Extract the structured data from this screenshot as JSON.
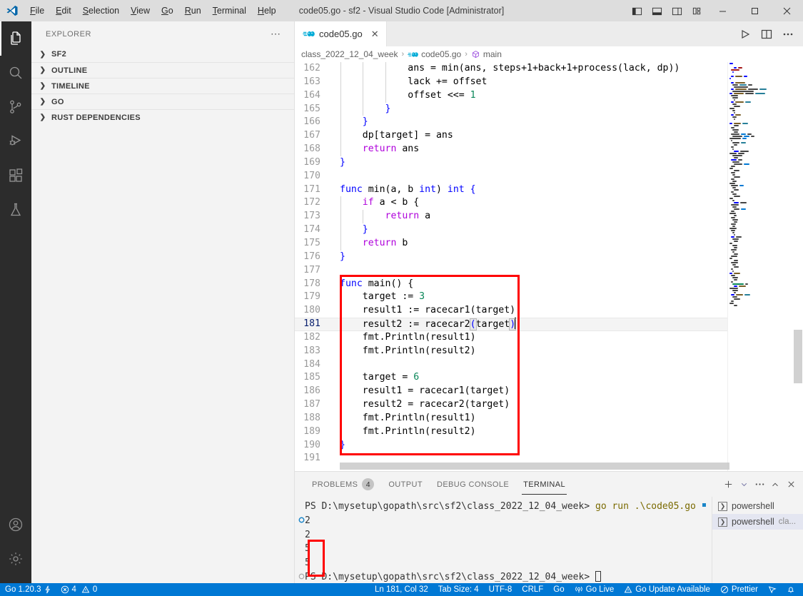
{
  "window": {
    "title": "code05.go - sf2 - Visual Studio Code [Administrator]",
    "menus": [
      {
        "label": "File",
        "mnemonic": "F"
      },
      {
        "label": "Edit",
        "mnemonic": "E"
      },
      {
        "label": "Selection",
        "mnemonic": "S"
      },
      {
        "label": "View",
        "mnemonic": "V"
      },
      {
        "label": "Go",
        "mnemonic": "G"
      },
      {
        "label": "Run",
        "mnemonic": "R"
      },
      {
        "label": "Terminal",
        "mnemonic": "T"
      },
      {
        "label": "Help",
        "mnemonic": "H"
      }
    ],
    "layout_buttons": [
      "toggle-primary-sidebar",
      "toggle-panel",
      "toggle-secondary-sidebar",
      "customize-layout"
    ],
    "controls": {
      "minimize": "─",
      "maximize": "☐",
      "close": "✕"
    }
  },
  "activitybar": {
    "items": [
      {
        "name": "explorer",
        "icon": "files-icon",
        "active": true
      },
      {
        "name": "search",
        "icon": "search-icon",
        "active": false
      },
      {
        "name": "source-control",
        "icon": "source-control-icon",
        "active": false
      },
      {
        "name": "run-and-debug",
        "icon": "debug-icon",
        "active": false
      },
      {
        "name": "extensions",
        "icon": "extensions-icon",
        "active": false
      },
      {
        "name": "testing",
        "icon": "beaker-icon",
        "active": false
      }
    ],
    "bottom": [
      {
        "name": "accounts",
        "icon": "account-icon"
      },
      {
        "name": "manage",
        "icon": "gear-icon"
      }
    ]
  },
  "sidebar": {
    "title": "EXPLORER",
    "more_actions": "⋯",
    "sections": [
      {
        "label": "SF2",
        "expanded": false
      },
      {
        "label": "OUTLINE",
        "expanded": false
      },
      {
        "label": "TIMELINE",
        "expanded": false
      },
      {
        "label": "GO",
        "expanded": false
      },
      {
        "label": "RUST DEPENDENCIES",
        "expanded": false
      }
    ]
  },
  "editor": {
    "tab": {
      "label": "code05.go",
      "icon": "go-file-icon",
      "close": "✕"
    },
    "tab_actions": [
      {
        "name": "run-code",
        "icon": "play-icon"
      },
      {
        "name": "split-editor",
        "icon": "split-icon"
      },
      {
        "name": "more-actions",
        "icon": "ellipsis-icon"
      }
    ],
    "breadcrumb": [
      "class_2022_12_04_week",
      "code05.go",
      "main"
    ],
    "first_line_number": 162,
    "lines": [
      {
        "n": 162,
        "indent": 3,
        "tokens": [
          {
            "t": "            ans = min(ans, steps+1+back+1+process(lack, dp))",
            "c": "pl"
          }
        ],
        "clipped": true
      },
      {
        "n": 163,
        "indent": 3,
        "tokens": [
          {
            "t": "            lack += offset",
            "c": "pl"
          }
        ]
      },
      {
        "n": 164,
        "indent": 3,
        "tokens": [
          {
            "t": "            offset <<= ",
            "c": "pl"
          },
          {
            "t": "1",
            "c": "num"
          }
        ]
      },
      {
        "n": 165,
        "indent": 2,
        "tokens": [
          {
            "t": "        }",
            "c": "brace"
          }
        ]
      },
      {
        "n": 166,
        "indent": 1,
        "tokens": [
          {
            "t": "    }",
            "c": "brace"
          }
        ]
      },
      {
        "n": 167,
        "indent": 1,
        "tokens": [
          {
            "t": "    dp[target] = ans",
            "c": "pl"
          }
        ]
      },
      {
        "n": 168,
        "indent": 1,
        "tokens": [
          {
            "t": "    ",
            "c": "pl"
          },
          {
            "t": "return",
            "c": "kw2"
          },
          {
            "t": " ans",
            "c": "pl"
          }
        ]
      },
      {
        "n": 169,
        "indent": 0,
        "tokens": [
          {
            "t": "}",
            "c": "brace"
          }
        ]
      },
      {
        "n": 170,
        "indent": 0,
        "tokens": [
          {
            "t": "",
            "c": "pl"
          }
        ]
      },
      {
        "n": 171,
        "indent": 0,
        "tokens": [
          {
            "t": "func",
            "c": "kw"
          },
          {
            "t": " min(a, b ",
            "c": "pl"
          },
          {
            "t": "int",
            "c": "kw"
          },
          {
            "t": ") ",
            "c": "pl"
          },
          {
            "t": "int",
            "c": "kw"
          },
          {
            "t": " {",
            "c": "brace"
          }
        ]
      },
      {
        "n": 172,
        "indent": 1,
        "tokens": [
          {
            "t": "    ",
            "c": "pl"
          },
          {
            "t": "if",
            "c": "kw2"
          },
          {
            "t": " a < b {",
            "c": "pl"
          }
        ]
      },
      {
        "n": 173,
        "indent": 2,
        "tokens": [
          {
            "t": "        ",
            "c": "pl"
          },
          {
            "t": "return",
            "c": "kw2"
          },
          {
            "t": " a",
            "c": "pl"
          }
        ]
      },
      {
        "n": 174,
        "indent": 1,
        "tokens": [
          {
            "t": "    }",
            "c": "brace"
          }
        ]
      },
      {
        "n": 175,
        "indent": 1,
        "tokens": [
          {
            "t": "    ",
            "c": "pl"
          },
          {
            "t": "return",
            "c": "kw2"
          },
          {
            "t": " b",
            "c": "pl"
          }
        ]
      },
      {
        "n": 176,
        "indent": 0,
        "tokens": [
          {
            "t": "}",
            "c": "brace"
          }
        ]
      },
      {
        "n": 177,
        "indent": 0,
        "tokens": [
          {
            "t": "",
            "c": "pl"
          }
        ]
      },
      {
        "n": 178,
        "indent": 0,
        "tokens": [
          {
            "t": "func",
            "c": "kw"
          },
          {
            "t": " main() {",
            "c": "pl"
          }
        ]
      },
      {
        "n": 179,
        "indent": 1,
        "tokens": [
          {
            "t": "    target := ",
            "c": "pl"
          },
          {
            "t": "3",
            "c": "num"
          }
        ]
      },
      {
        "n": 180,
        "indent": 1,
        "tokens": [
          {
            "t": "    result1 := racecar1(target)",
            "c": "pl"
          }
        ]
      },
      {
        "n": 181,
        "indent": 1,
        "current": true,
        "tokens": [
          {
            "t": "    result2 := racecar2",
            "c": "pl"
          },
          {
            "t": "(",
            "c": "match"
          },
          {
            "t": "target",
            "c": "pl"
          },
          {
            "t": ")",
            "c": "match"
          }
        ],
        "cursor": true
      },
      {
        "n": 182,
        "indent": 1,
        "tokens": [
          {
            "t": "    fmt.Println(result1)",
            "c": "pl"
          }
        ]
      },
      {
        "n": 183,
        "indent": 1,
        "tokens": [
          {
            "t": "    fmt.Println(result2)",
            "c": "pl"
          }
        ]
      },
      {
        "n": 184,
        "indent": 1,
        "tokens": [
          {
            "t": "",
            "c": "pl"
          }
        ]
      },
      {
        "n": 185,
        "indent": 1,
        "tokens": [
          {
            "t": "    target = ",
            "c": "pl"
          },
          {
            "t": "6",
            "c": "num"
          }
        ]
      },
      {
        "n": 186,
        "indent": 1,
        "tokens": [
          {
            "t": "    result1 = racecar1(target)",
            "c": "pl"
          }
        ]
      },
      {
        "n": 187,
        "indent": 1,
        "tokens": [
          {
            "t": "    result2 = racecar2(target)",
            "c": "pl"
          }
        ]
      },
      {
        "n": 188,
        "indent": 1,
        "tokens": [
          {
            "t": "    fmt.Println(result1)",
            "c": "pl"
          }
        ]
      },
      {
        "n": 189,
        "indent": 1,
        "tokens": [
          {
            "t": "    fmt.Println(result2)",
            "c": "pl"
          }
        ]
      },
      {
        "n": 190,
        "indent": 0,
        "tokens": [
          {
            "t": "}",
            "c": "brace"
          }
        ]
      },
      {
        "n": 191,
        "indent": 0,
        "tokens": [
          {
            "t": "",
            "c": "pl"
          }
        ]
      }
    ],
    "annotation_box": {
      "from_line": 178,
      "to_line": 190,
      "color": "#ff0000"
    }
  },
  "panel": {
    "tabs": [
      {
        "label": "PROBLEMS",
        "badge": "4",
        "active": false
      },
      {
        "label": "OUTPUT",
        "badge": null,
        "active": false
      },
      {
        "label": "DEBUG CONSOLE",
        "badge": null,
        "active": false
      },
      {
        "label": "TERMINAL",
        "badge": null,
        "active": true
      }
    ],
    "actions": [
      {
        "name": "new-terminal",
        "icon": "plus-icon"
      },
      {
        "name": "terminal-profile",
        "icon": "chevron-down-icon"
      },
      {
        "name": "views-and-more-actions",
        "icon": "ellipsis-icon"
      },
      {
        "name": "maximize-panel",
        "icon": "chevron-up-icon"
      },
      {
        "name": "close-panel",
        "icon": "close-icon"
      }
    ],
    "terminal": {
      "prompt": "PS D:\\mysetup\\gopath\\src\\sf2\\class_2022_12_04_week>",
      "command": "go run .\\code05.go",
      "output": [
        "2",
        "2",
        "5",
        "5"
      ],
      "last_prompt": "PS D:\\mysetup\\gopath\\src\\sf2\\class_2022_12_04_week>",
      "annotation_color": "#ff0000"
    },
    "terminal_list": [
      {
        "label": "powershell",
        "sub": "",
        "icon": "terminal-icon",
        "selected": false
      },
      {
        "label": "powershell",
        "sub": "cla...",
        "icon": "terminal-icon",
        "selected": true
      }
    ]
  },
  "statusbar": {
    "left": [
      {
        "name": "go-version",
        "label": "Go 1.20.3",
        "icon": "zap-icon"
      },
      {
        "name": "problems",
        "label": "4",
        "label2": "0",
        "icon": "error-icon",
        "icon2": "warning-icon"
      }
    ],
    "right": [
      {
        "name": "editor-position",
        "label": "Ln 181, Col 32"
      },
      {
        "name": "tab-size",
        "label": "Tab Size: 4"
      },
      {
        "name": "encoding",
        "label": "UTF-8"
      },
      {
        "name": "eol",
        "label": "CRLF"
      },
      {
        "name": "language-mode",
        "label": "Go"
      },
      {
        "name": "go-live",
        "label": "Go Live",
        "icon": "broadcast-icon"
      },
      {
        "name": "go-update",
        "label": "Go Update Available",
        "icon": "warning-icon"
      },
      {
        "name": "prettier",
        "label": "Prettier",
        "icon": "prettier-icon"
      },
      {
        "name": "feedback",
        "label": "",
        "icon": "feedback-icon"
      },
      {
        "name": "notifications",
        "label": "",
        "icon": "bell-icon"
      }
    ],
    "background": "#0078d4"
  }
}
